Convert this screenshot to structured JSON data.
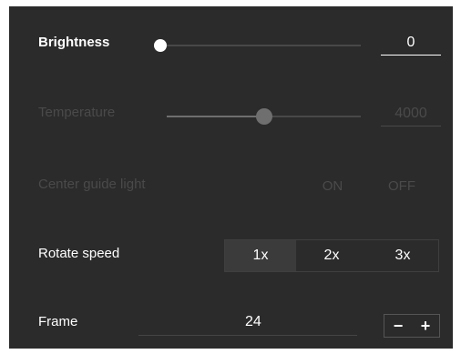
{
  "brightness": {
    "label": "Brightness",
    "value": "0",
    "level": 0,
    "enabled": true
  },
  "temperature": {
    "label": "Temperature",
    "value": "4000",
    "level": 0.5,
    "enabled": false
  },
  "center_guide_light": {
    "label": "Center guide light",
    "on_label": "ON",
    "off_label": "OFF",
    "enabled": false
  },
  "rotate_speed": {
    "label": "Rotate speed",
    "options": [
      "1x",
      "2x",
      "3x"
    ],
    "selected": "1x"
  },
  "frame": {
    "label": "Frame",
    "value": "24",
    "decrement_label": "−",
    "increment_label": "+"
  },
  "colors": {
    "panel_bg": "#2b2b2b",
    "active_text": "#ffffff",
    "disabled_text": "#4a4a4a",
    "knob_active": "#ffffff",
    "knob_disabled": "#6f6f6f"
  }
}
